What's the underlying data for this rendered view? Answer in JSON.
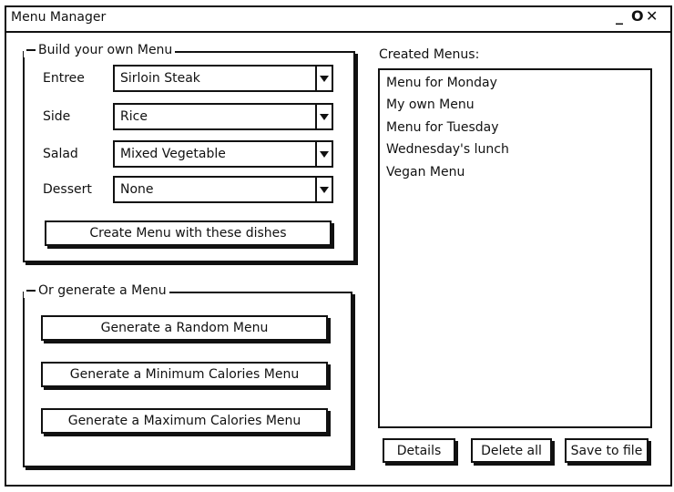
{
  "window": {
    "title": "Menu Manager",
    "controls": {
      "minimize": "_",
      "maximize": "O",
      "close": "✕"
    }
  },
  "build": {
    "legend": "Build your own Menu",
    "fields": [
      {
        "label": "Entree",
        "value": "Sirloin Steak"
      },
      {
        "label": "Side",
        "value": "Rice"
      },
      {
        "label": "Salad",
        "value": "Mixed Vegetable"
      },
      {
        "label": "Dessert",
        "value": "None"
      }
    ],
    "create_button": "Create Menu with these dishes"
  },
  "generate": {
    "legend": "Or generate a Menu",
    "buttons": [
      "Generate a Random Menu",
      "Generate a Minimum Calories Menu",
      "Generate a Maximum Calories Menu"
    ]
  },
  "created": {
    "label": "Created Menus:",
    "items": [
      "Menu for Monday",
      "My own Menu",
      "Menu for Tuesday",
      "Wednesday's lunch",
      "Vegan Menu"
    ],
    "buttons": {
      "details": "Details",
      "delete_all": "Delete all",
      "save": "Save to file"
    }
  }
}
